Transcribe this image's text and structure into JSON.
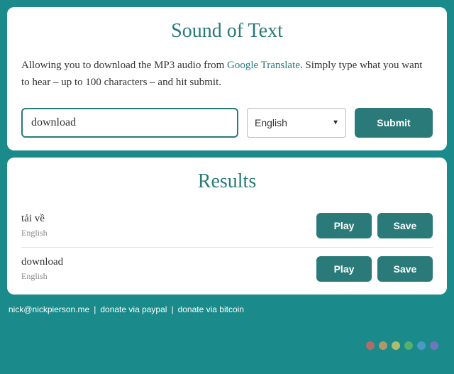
{
  "header": {
    "title": "Sound of Text",
    "description_pre": "Allowing you to download the MP3 audio from ",
    "description_link": "Google Translate",
    "description_post": ". Simply type what you want to hear – up to 100 characters – and hit submit."
  },
  "form": {
    "input_value": "download",
    "language_selected": "English",
    "submit_label": "Submit"
  },
  "results": {
    "title": "Results",
    "items": [
      {
        "text": "tải về",
        "language": "English",
        "play": "Play",
        "save": "Save"
      },
      {
        "text": "download",
        "language": "English",
        "play": "Play",
        "save": "Save"
      }
    ]
  },
  "footer": {
    "email": "nick@nickpierson.me",
    "paypal": "donate via paypal",
    "bitcoin": "donate via bitcoin"
  },
  "watermark_colors": [
    "#f06060",
    "#f0a060",
    "#f0d060",
    "#70c060",
    "#60a0e0",
    "#9070d0"
  ]
}
